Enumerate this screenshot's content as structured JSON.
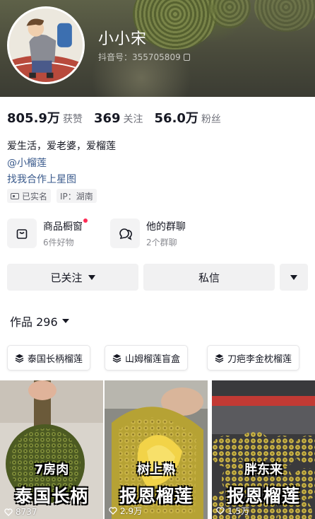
{
  "profile": {
    "nickname": "小小宋",
    "douyin_id": "抖音号：355705809"
  },
  "stats": [
    {
      "num": "805.9万",
      "label": "获赞"
    },
    {
      "num": "369",
      "label": "关注"
    },
    {
      "num": "56.0万",
      "label": "粉丝"
    }
  ],
  "bio": "爱生活，爱老婆，爱榴莲",
  "mention": "@小榴莲",
  "collab": "找我合作上星图",
  "tags": {
    "verified": "已实名",
    "ip": "IP：湖南"
  },
  "features": [
    {
      "title": "商品橱窗",
      "sub": "6件好物",
      "icon": "shopping-bag-icon"
    },
    {
      "title": "他的群聊",
      "sub": "2个群聊",
      "icon": "group-chat-icon"
    }
  ],
  "actions": {
    "followed": "已关注",
    "message": "私信"
  },
  "works": {
    "label": "作品 296"
  },
  "collections": [
    {
      "label": "泰国长柄榴莲"
    },
    {
      "label": "山姆榴莲盲盒"
    },
    {
      "label": "刀疤李金枕榴莲"
    }
  ],
  "videos": [
    {
      "line1": "7房肉",
      "line2": "泰国长柄",
      "likes": "8737"
    },
    {
      "line1": "树上熟",
      "line2": "报恩榴莲",
      "likes": "2.9万"
    },
    {
      "line1": "胖东来",
      "line2": "报恩榴莲",
      "likes": "1.5万"
    }
  ],
  "colors": {
    "accent_red": "#fe2c55",
    "link_blue": "#3a5a8c"
  }
}
